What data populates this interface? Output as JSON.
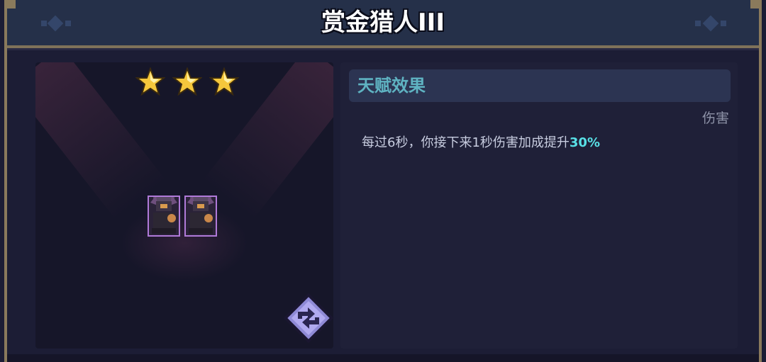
{
  "window": {
    "title": "赏金猎人III"
  },
  "hero": {
    "star_count": 3,
    "star_color": "#f5c73c",
    "card_border_color": "#b07ad9",
    "character_icons": [
      "bounty-hunter-icon",
      "bounty-hunter-icon"
    ]
  },
  "talent": {
    "section_title": "天赋效果",
    "tag": "伤害",
    "description_prefix": "每过6秒，你接下来1秒伤害加成提升",
    "description_value": "30%",
    "accent_color": "#58e0e6"
  },
  "actions": {
    "refresh_icon": "refresh-icon"
  }
}
